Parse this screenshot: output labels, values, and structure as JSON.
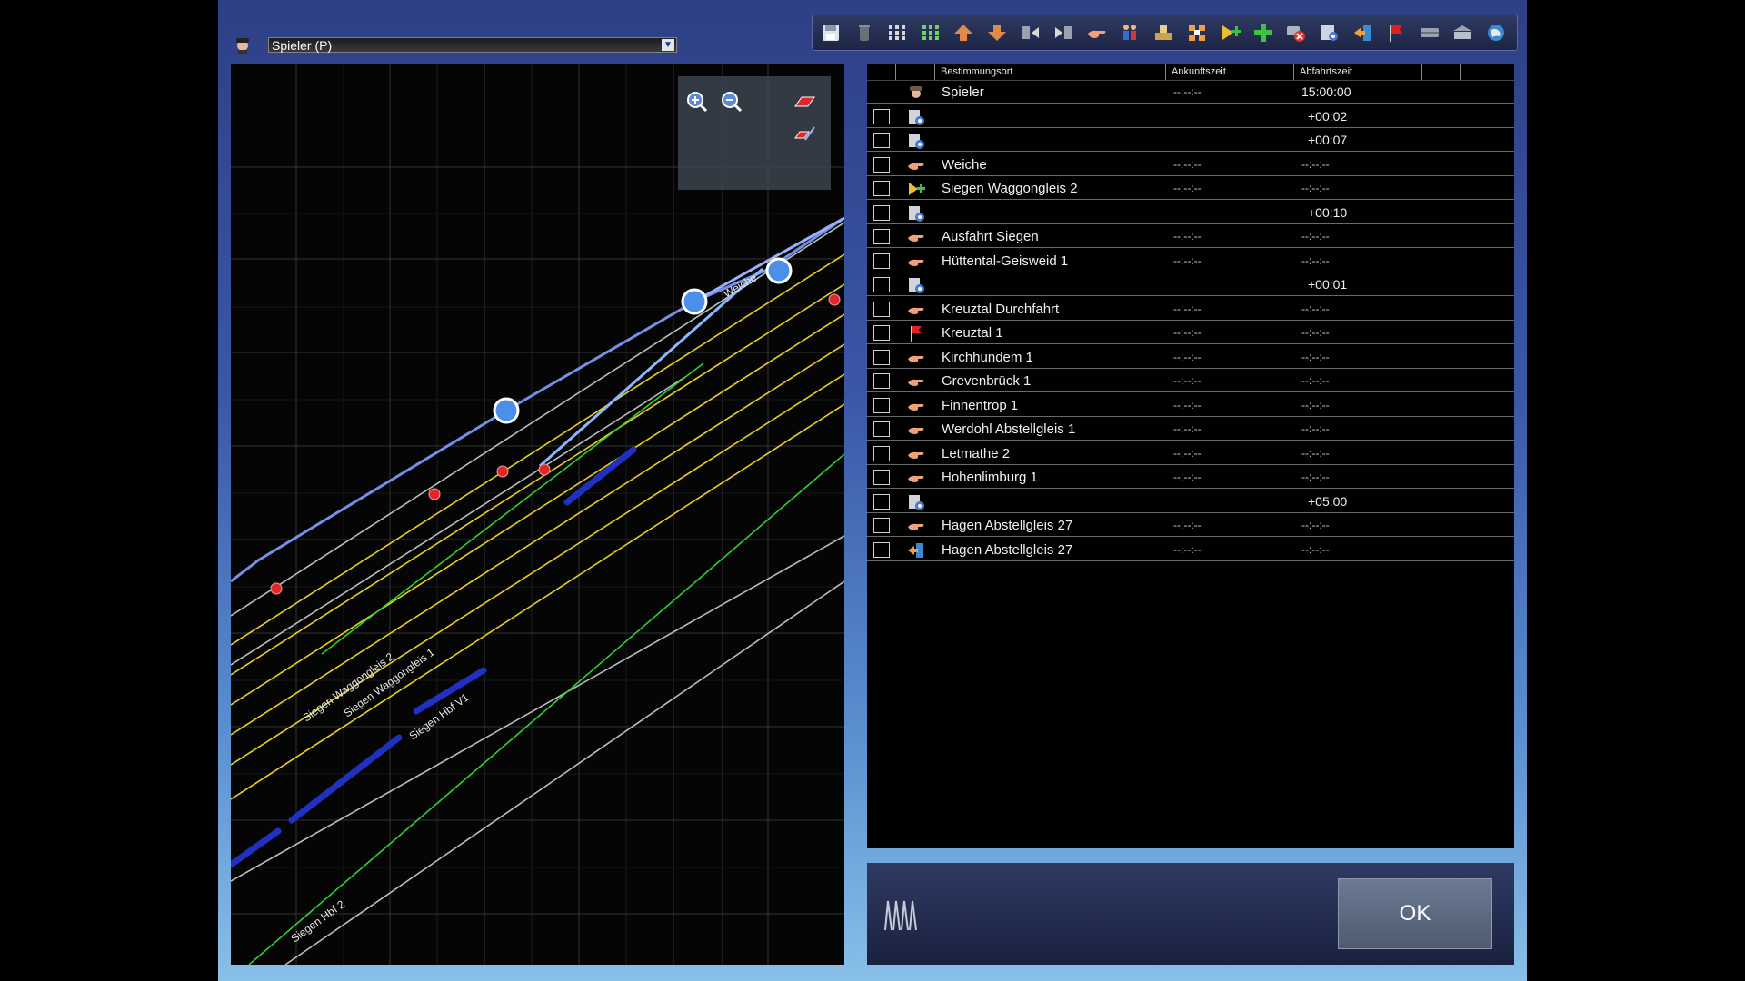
{
  "player": {
    "selected": "Spieler (P)"
  },
  "toolbar": {
    "icons": [
      "save-icon",
      "trash-icon",
      "grid-small-icon",
      "grid-green-icon",
      "move-up-icon",
      "move-down-icon",
      "insert-before-icon",
      "insert-after-icon",
      "hand-point-icon",
      "passengers-icon",
      "load-icon",
      "couple-icon",
      "add-destination-icon",
      "add-green-icon",
      "delete-red-icon",
      "settings-icon",
      "exit-icon",
      "flag-icon",
      "wagon-icon",
      "station-icon",
      "globe-icon"
    ]
  },
  "map": {
    "labels": [
      "Weiche",
      "Siegen Waggongleis 2",
      "Siegen Waggongleis 1",
      "Siegen Hbf V1",
      "Siegen Hbf 2"
    ]
  },
  "schedule": {
    "headers": {
      "destination": "Bestimmungsort",
      "arrival": "Ankunftszeit",
      "departure": "Abfahrtszeit"
    },
    "rows": [
      {
        "icon": "driver",
        "dest": "Spieler",
        "arr": "--:--:--",
        "dep": "15:00:00",
        "check": false
      },
      {
        "icon": "wait",
        "dest": "",
        "arr": "",
        "dep": "+00:02",
        "check": true
      },
      {
        "icon": "wait",
        "dest": "",
        "arr": "",
        "dep": "+00:07",
        "check": true
      },
      {
        "icon": "hand",
        "dest": "Weiche",
        "arr": "--:--:--",
        "dep": "--:--:--",
        "check": true
      },
      {
        "icon": "add-wagon",
        "dest": "Siegen Waggongleis 2",
        "arr": "--:--:--",
        "dep": "--:--:--",
        "check": true
      },
      {
        "icon": "wait",
        "dest": "",
        "arr": "",
        "dep": "+00:10",
        "check": true
      },
      {
        "icon": "hand",
        "dest": "Ausfahrt Siegen",
        "arr": "--:--:--",
        "dep": "--:--:--",
        "check": true
      },
      {
        "icon": "hand",
        "dest": "Hüttental-Geisweid 1",
        "arr": "--:--:--",
        "dep": "--:--:--",
        "check": true
      },
      {
        "icon": "wait",
        "dest": "",
        "arr": "",
        "dep": "+00:01",
        "check": true
      },
      {
        "icon": "hand",
        "dest": "Kreuztal Durchfahrt",
        "arr": "--:--:--",
        "dep": "--:--:--",
        "check": true
      },
      {
        "icon": "flag",
        "dest": "Kreuztal 1",
        "arr": "--:--:--",
        "dep": "--:--:--",
        "check": true
      },
      {
        "icon": "hand",
        "dest": "Kirchhundem 1",
        "arr": "--:--:--",
        "dep": "--:--:--",
        "check": true
      },
      {
        "icon": "hand",
        "dest": "Grevenbrück 1",
        "arr": "--:--:--",
        "dep": "--:--:--",
        "check": true
      },
      {
        "icon": "hand",
        "dest": "Finnentrop 1",
        "arr": "--:--:--",
        "dep": "--:--:--",
        "check": true
      },
      {
        "icon": "hand",
        "dest": "Werdohl Abstellgleis 1",
        "arr": "--:--:--",
        "dep": "--:--:--",
        "check": true
      },
      {
        "icon": "hand",
        "dest": "Letmathe 2",
        "arr": "--:--:--",
        "dep": "--:--:--",
        "check": true
      },
      {
        "icon": "hand",
        "dest": "Hohenlimburg 1",
        "arr": "--:--:--",
        "dep": "--:--:--",
        "check": true
      },
      {
        "icon": "wait",
        "dest": "",
        "arr": "",
        "dep": "+05:00",
        "check": true
      },
      {
        "icon": "hand",
        "dest": "Hagen Abstellgleis 27",
        "arr": "--:--:--",
        "dep": "--:--:--",
        "check": true
      },
      {
        "icon": "exit",
        "dest": "Hagen Abstellgleis 27",
        "arr": "--:--:--",
        "dep": "--:--:--",
        "check": true
      }
    ]
  },
  "ok_label": "OK"
}
